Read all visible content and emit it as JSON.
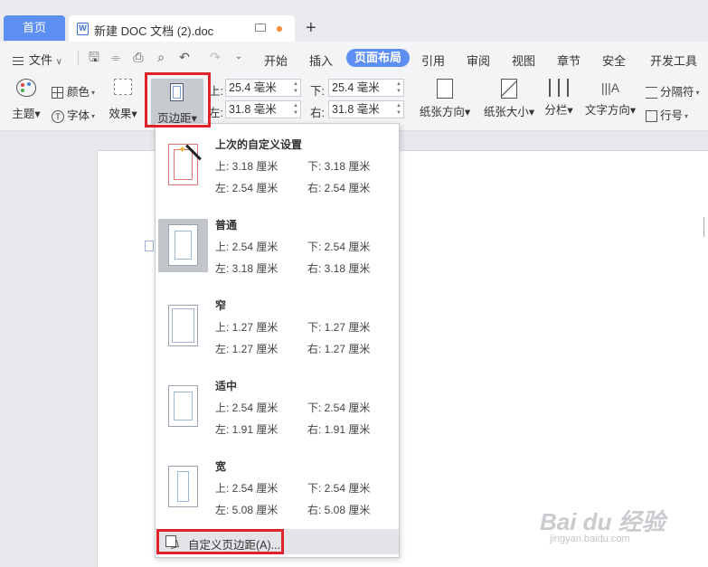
{
  "tabs": {
    "home": "首页",
    "document_title": "新建 DOC 文档 (2).doc",
    "new_tab": "+"
  },
  "menu": {
    "file": "文件",
    "items": [
      "开始",
      "插入",
      "页面布局",
      "引用",
      "审阅",
      "视图",
      "章节",
      "安全",
      "开发工具"
    ],
    "active": "页面布局"
  },
  "ribbon": {
    "theme": "主题",
    "colors": "颜色",
    "fonts": "字体",
    "effects": "效果",
    "margins": "页边距",
    "top_label": "上:",
    "top_value": "25.4 毫米",
    "bottom_label": "下:",
    "bottom_value": "25.4 毫米",
    "left_label": "左:",
    "left_value": "31.8 毫米",
    "right_label": "右:",
    "right_value": "31.8 毫米",
    "orientation": "纸张方向",
    "size": "纸张大小",
    "columns": "分栏",
    "text_direction": "文字方向",
    "breaks": "分隔符",
    "line_numbers": "行号"
  },
  "margin_presets": [
    {
      "name": "上次的自定义设置",
      "top": "上: 3.18 厘米",
      "bottom": "下: 3.18 厘米",
      "left": "左: 2.54 厘米",
      "right": "右: 2.54 厘米"
    },
    {
      "name": "普通",
      "top": "上: 2.54 厘米",
      "bottom": "下: 2.54 厘米",
      "left": "左: 3.18 厘米",
      "right": "右: 3.18 厘米"
    },
    {
      "name": "窄",
      "top": "上: 1.27 厘米",
      "bottom": "下: 1.27 厘米",
      "left": "左: 1.27 厘米",
      "right": "右: 1.27 厘米"
    },
    {
      "name": "适中",
      "top": "上: 2.54 厘米",
      "bottom": "下: 2.54 厘米",
      "left": "左: 1.91 厘米",
      "right": "右: 1.91 厘米"
    },
    {
      "name": "宽",
      "top": "上: 2.54 厘米",
      "bottom": "下: 2.54 厘米",
      "left": "左: 5.08 厘米",
      "right": "右: 5.08 厘米"
    }
  ],
  "custom_margins": "自定义页边距(A)...",
  "watermark": {
    "text": "Bai du 经验",
    "sub": "jingyan.baidu.com"
  },
  "colors": {
    "accent": "#5d8ff3",
    "highlight": "#e0222a"
  }
}
